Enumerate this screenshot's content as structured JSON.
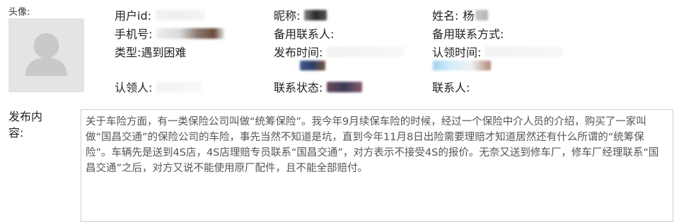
{
  "avatar": {
    "label": "头像:"
  },
  "fields": {
    "user_id_label": "用户id:",
    "nickname_label": "昵称:",
    "name_label": "姓名:",
    "name_value": "杨",
    "phone_label": "手机号:",
    "backup_contact_label": "备用联系人:",
    "backup_contact_method_label": "备用联系方式:",
    "type_label": "类型:",
    "type_value": "遇到困难",
    "publish_time_label": "发布时间:",
    "claim_time_label": "认领时间:",
    "claimer_label": "认领人:",
    "contact_status_label": "联系状态:",
    "contact_person_label": "联系人:"
  },
  "content": {
    "label_line1": "发布内",
    "label_line2": "容:",
    "text": "关于车险方面，有一类保险公司叫做“统筹保险”。我今年9月续保车险的时候，经过一个保险中介人员的介绍，购买了一家叫做“国昌交通”的保险公司的车险，事先当然不知道是坑，直到今年11月8日出险需要理赔才知道居然还有什么所谓的“统筹保险”。车辆先是送到4S店，4S店理赔专员联系“国昌交通”，对方表示不接受4S的报价。无奈又送到修车厂，修车厂经理联系“国昌交通”之后，对方又说不能使用原厂配件，且不能全部赔付。"
  },
  "colors": {
    "avatar_bg": "#e4e4e4",
    "avatar_silhouette": "#c8c8c8",
    "border": "#cfcfcf",
    "content_text": "#555555"
  }
}
